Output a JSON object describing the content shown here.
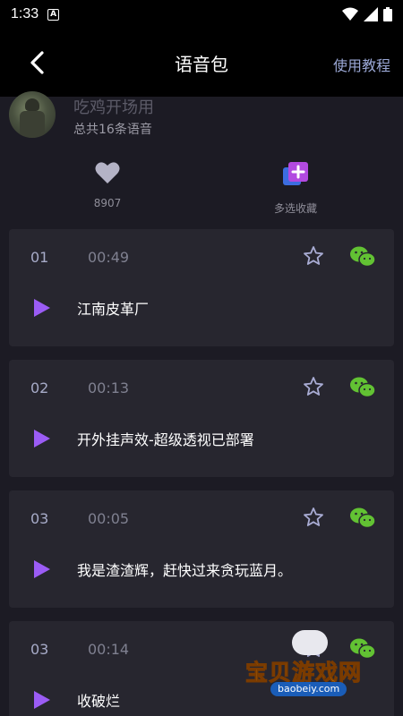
{
  "status_bar": {
    "time": "1:33",
    "notif_glyph": "A",
    "icons": [
      "wifi-icon",
      "signal-icon",
      "battery-icon"
    ]
  },
  "header": {
    "title": "语音包",
    "tutorial_link": "使用教程"
  },
  "pack": {
    "name": "吃鸡开场用",
    "count": "总共16条语音"
  },
  "actions": {
    "likes": "8907",
    "multi_collect": "多选收藏"
  },
  "voices": [
    {
      "index": "01",
      "duration": "00:49",
      "name": "江南皮革厂"
    },
    {
      "index": "02",
      "duration": "00:13",
      "name": "开外挂声效-超级透视已部署"
    },
    {
      "index": "03",
      "duration": "00:05",
      "name": "我是渣渣辉，赶快过来贪玩蓝月。"
    },
    {
      "index": "03",
      "duration": "00:14",
      "name": "收破烂"
    }
  ],
  "watermark": {
    "name": "宝贝游戏网",
    "url": "baobeiy.com"
  },
  "colors": {
    "accent_purple": "#9b5cf5",
    "wechat_green": "#62c233",
    "link_blue": "#9ba8d6",
    "card_bg": "#27262f",
    "page_bg": "#1c1b24"
  }
}
